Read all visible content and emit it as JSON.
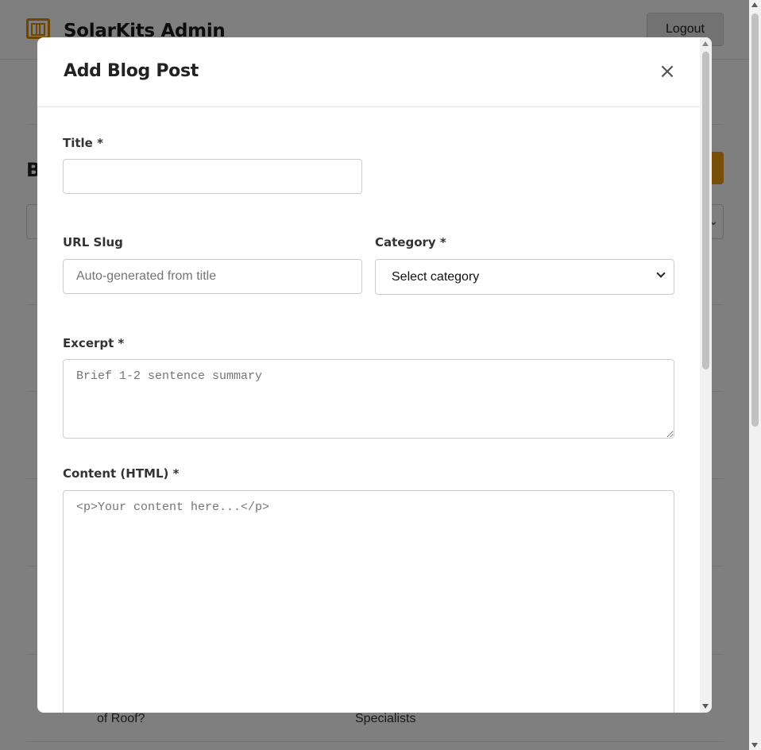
{
  "app": {
    "title": "SolarKits Admin",
    "logout_label": "Logout",
    "page_heading_initial": "B",
    "rows": [
      {
        "col1": "of Roof?",
        "col2": "Specialists"
      }
    ]
  },
  "modal": {
    "title": "Add Blog Post",
    "close_glyph": "×",
    "fields": {
      "title": {
        "label": "Title *",
        "value": "",
        "placeholder": ""
      },
      "slug": {
        "label": "URL Slug",
        "value": "",
        "placeholder": "Auto-generated from title"
      },
      "category": {
        "label": "Category *",
        "selected": "Select category"
      },
      "excerpt": {
        "label": "Excerpt *",
        "value": "",
        "placeholder": "Brief 1-2 sentence summary"
      },
      "content": {
        "label": "Content (HTML) *",
        "value": "",
        "placeholder": "<p>Your content here...</p>"
      }
    }
  },
  "colors": {
    "accent": "#f39c12",
    "logo": "#e08a00",
    "overlay": "rgba(0,0,0,0.5)"
  },
  "icons": {
    "logo": "solar-panel-icon",
    "close": "close-icon",
    "chevron": "chevron-down-icon"
  }
}
